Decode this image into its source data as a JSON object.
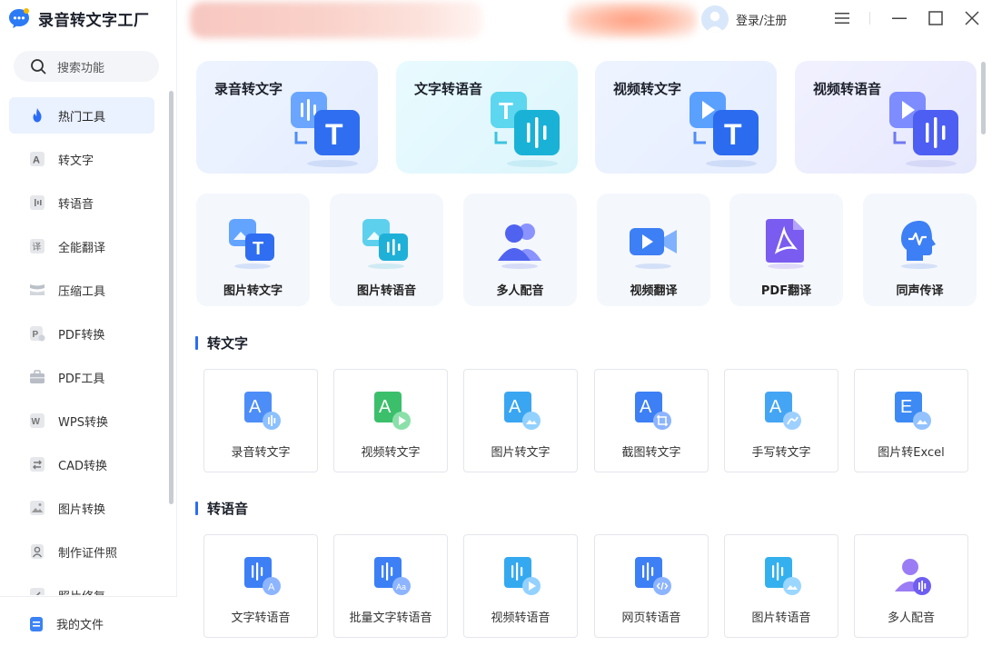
{
  "app": {
    "title": "录音转文字工厂"
  },
  "search": {
    "label": "搜索功能"
  },
  "sidebar": {
    "items": [
      {
        "label": "热门工具",
        "icon": "flame-icon",
        "active": true
      },
      {
        "label": "转文字",
        "icon": "text-a-icon"
      },
      {
        "label": "转语音",
        "icon": "voice-icon"
      },
      {
        "label": "全能翻译",
        "icon": "translate-icon"
      },
      {
        "label": "压缩工具",
        "icon": "compress-icon"
      },
      {
        "label": "PDF转换",
        "icon": "pdf-convert-icon"
      },
      {
        "label": "PDF工具",
        "icon": "toolbox-icon"
      },
      {
        "label": "WPS转换",
        "icon": "wps-icon"
      },
      {
        "label": "CAD转换",
        "icon": "cad-icon"
      },
      {
        "label": "图片转换",
        "icon": "image-icon"
      },
      {
        "label": "制作证件照",
        "icon": "id-photo-icon"
      },
      {
        "label": "照片修复",
        "icon": "photo-repair-icon"
      }
    ],
    "my_files": "我的文件"
  },
  "header": {
    "login": "登录/注册"
  },
  "features": [
    {
      "title": "录音转文字",
      "icon": "audio-to-text-icon"
    },
    {
      "title": "文字转语音",
      "icon": "text-to-audio-icon"
    },
    {
      "title": "视频转文字",
      "icon": "video-to-text-icon"
    },
    {
      "title": "视频转语音",
      "icon": "video-to-audio-icon"
    }
  ],
  "tools": [
    {
      "label": "图片转文字",
      "icon": "image-to-text-icon"
    },
    {
      "label": "图片转语音",
      "icon": "image-to-audio-icon"
    },
    {
      "label": "多人配音",
      "icon": "multi-voice-icon"
    },
    {
      "label": "视频翻译",
      "icon": "video-translate-icon"
    },
    {
      "label": "PDF翻译",
      "icon": "pdf-translate-icon"
    },
    {
      "label": "同声传译",
      "icon": "simultaneous-interpret-icon"
    }
  ],
  "sections": [
    {
      "title": "转文字",
      "cards": [
        {
          "label": "录音转文字",
          "icon": "audio-to-text-icon"
        },
        {
          "label": "视频转文字",
          "icon": "video-to-text-icon"
        },
        {
          "label": "图片转文字",
          "icon": "image-to-text-icon"
        },
        {
          "label": "截图转文字",
          "icon": "screenshot-to-text-icon"
        },
        {
          "label": "手写转文字",
          "icon": "handwriting-to-text-icon"
        },
        {
          "label": "图片转Excel",
          "icon": "image-to-excel-icon"
        }
      ]
    },
    {
      "title": "转语音",
      "cards": [
        {
          "label": "文字转语音",
          "icon": "text-to-speech-icon"
        },
        {
          "label": "批量文字转语音",
          "icon": "batch-text-to-speech-icon"
        },
        {
          "label": "视频转语音",
          "icon": "video-to-speech-icon"
        },
        {
          "label": "网页转语音",
          "icon": "webpage-to-speech-icon"
        },
        {
          "label": "图片转语音",
          "icon": "image-to-speech-icon"
        },
        {
          "label": "多人配音",
          "icon": "multi-voice-icon"
        }
      ]
    }
  ],
  "colors": {
    "accent": "#2b6cf6",
    "active_bg": "#eaf1ff",
    "tile_bg": "#f4f7fc"
  }
}
